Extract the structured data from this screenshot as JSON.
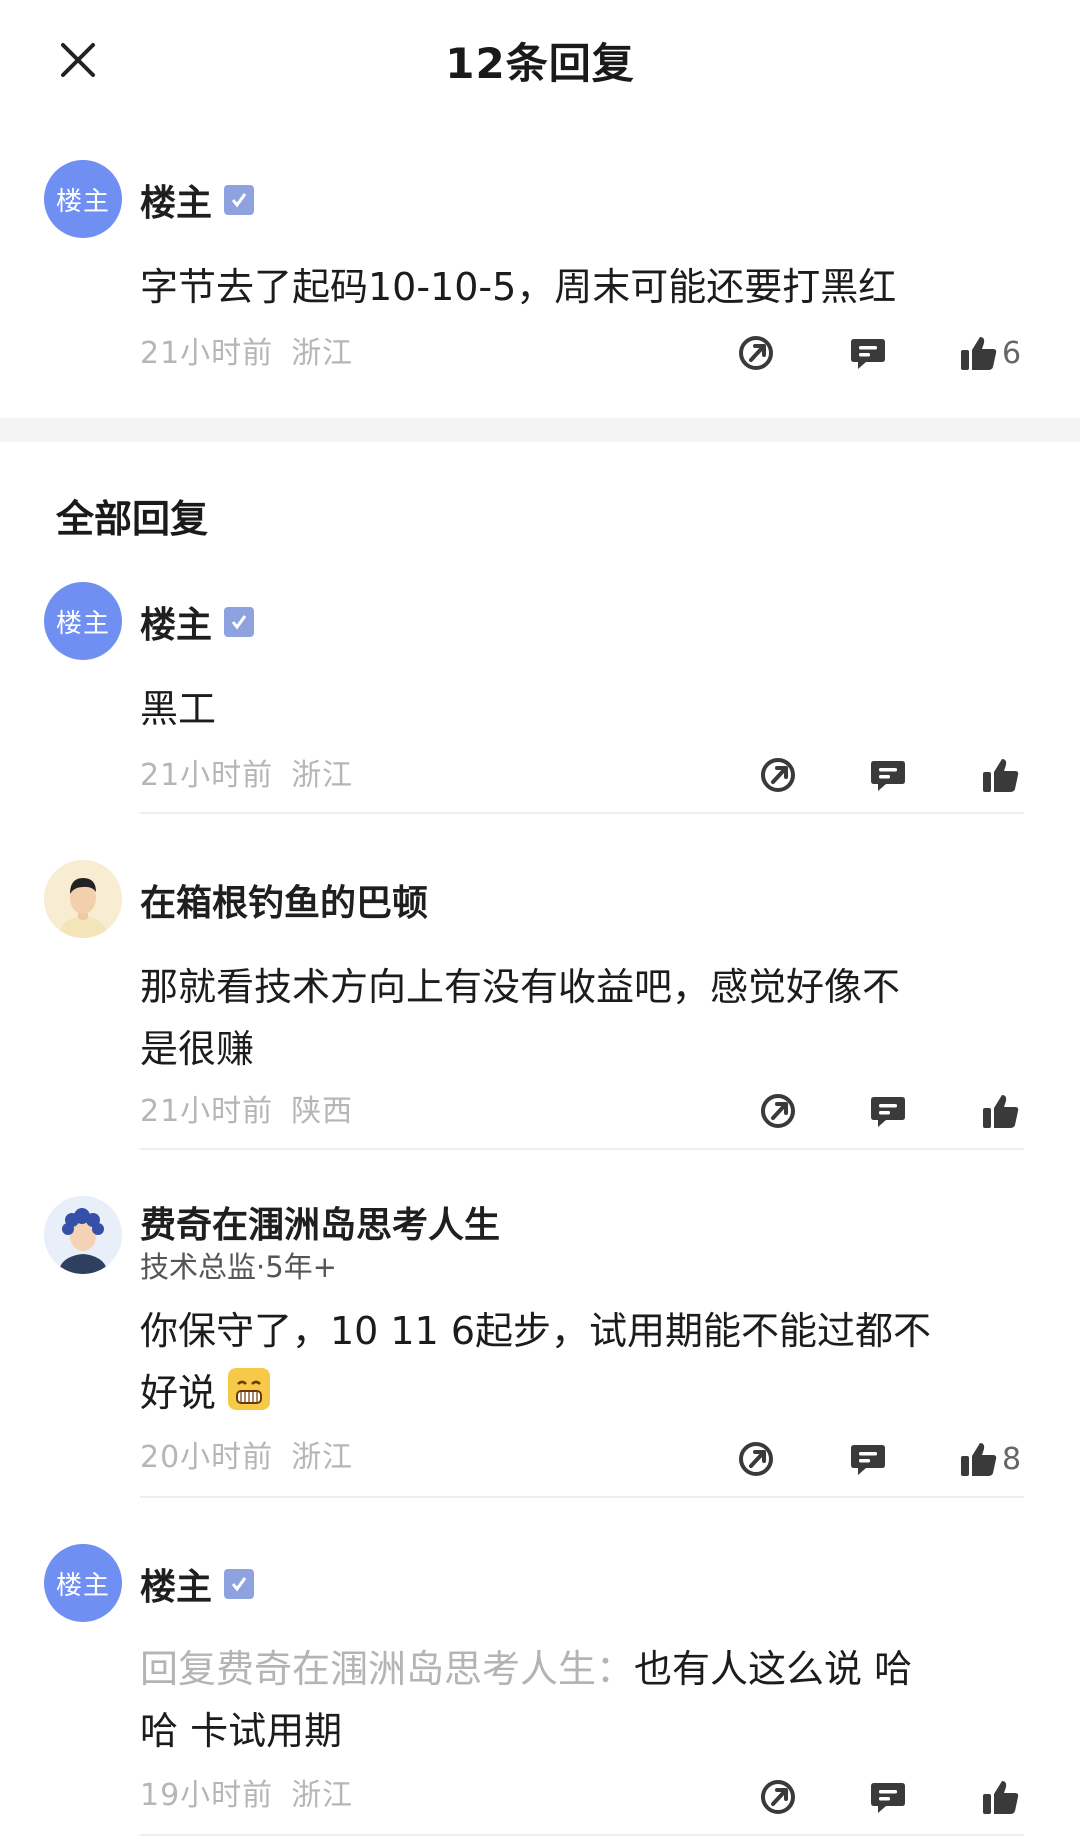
{
  "header": {
    "title": "12条回复"
  },
  "section_title": "全部回复",
  "comments": [
    {
      "avatar_text": "楼主",
      "username": "楼主",
      "verified": true,
      "content": "字节去了起码10-10-5，周末可能还要打黑红",
      "time": "21小时前",
      "region": "浙江",
      "likes": "6"
    },
    {
      "avatar_text": "楼主",
      "username": "楼主",
      "verified": true,
      "content": "黑工",
      "time": "21小时前",
      "region": "浙江",
      "likes": ""
    },
    {
      "username": "在箱根钓鱼的巴顿",
      "verified": false,
      "content_line1": "那就看技术方向上有没有收益吧，感觉好像不",
      "content_line2": "是很赚",
      "time": "21小时前",
      "region": "陕西",
      "likes": ""
    },
    {
      "username": "费奇在涠洲岛思考人生",
      "subtitle": "技术总监·5年+",
      "verified": false,
      "content_line1": "你保守了，10 11 6起步，试用期能不能过都不",
      "content_line2": "好说",
      "time": "20小时前",
      "region": "浙江",
      "likes": "8"
    },
    {
      "avatar_text": "楼主",
      "username": "楼主",
      "verified": true,
      "reply_prefix": "回复费奇在涠洲岛思考人生：",
      "content_line1_tail": "也有人这么说 哈",
      "content_line2": "哈 卡试用期",
      "time": "19小时前",
      "region": "浙江",
      "likes": ""
    }
  ],
  "colors": {
    "owner_avatar": "#6f8ff2",
    "verified_badge": "#8ea2df",
    "meta_text": "#b6b6b6",
    "icon": "#3a3a3a"
  },
  "icons": {
    "close": "close-icon",
    "share": "share-icon",
    "reply": "comment-icon",
    "like": "thumbs-up-icon"
  }
}
